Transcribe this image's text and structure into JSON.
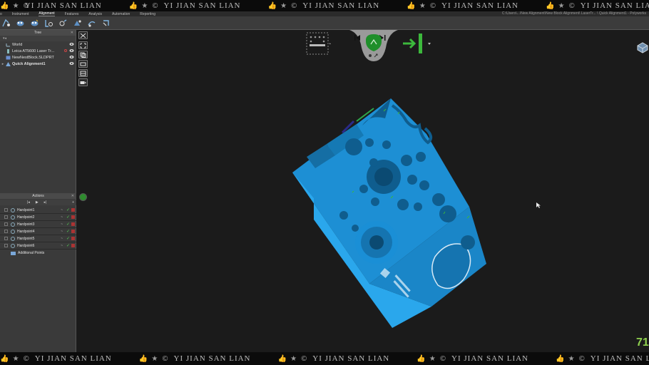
{
  "watermark": {
    "text": "YI JIAN SAN LIAN",
    "glyphs": "👍 ★ ©"
  },
  "menu": {
    "items": [
      "o",
      "Instrument",
      "Alignment",
      "Features",
      "Analysis",
      "Automation",
      "Reporting"
    ],
    "active_index": 2,
    "path": "C:\\Users\\...\\New Alignment\\New Block Alignment\\ LaserTr... \\ Quick Alignment1 - Polyworks"
  },
  "tree": {
    "title": "Tree",
    "items": [
      {
        "label": "World",
        "icon": "world-axis-icon",
        "expanded": false
      },
      {
        "label": "Leica AT5600 Laser Tr...",
        "icon": "laser-tracker-icon",
        "expanded": false
      },
      {
        "label": "NewNestBlock.SLDPRT",
        "icon": "cad-part-icon",
        "expanded": false
      },
      {
        "label": "Quick Alignment1",
        "icon": "alignment-icon",
        "expanded": true
      }
    ]
  },
  "actions": {
    "title": "Actions",
    "items": [
      {
        "label": "Hardpoint1"
      },
      {
        "label": "Hardpoint2"
      },
      {
        "label": "Hardpoint3"
      },
      {
        "label": "Hardpoint4"
      },
      {
        "label": "Hardpoint5"
      },
      {
        "label": "Hardpoint6"
      }
    ],
    "additional": "Additional Points"
  },
  "viewport": {
    "counter": "71",
    "accent_green": "#3cb93c",
    "model_color": "#1e9be0"
  }
}
